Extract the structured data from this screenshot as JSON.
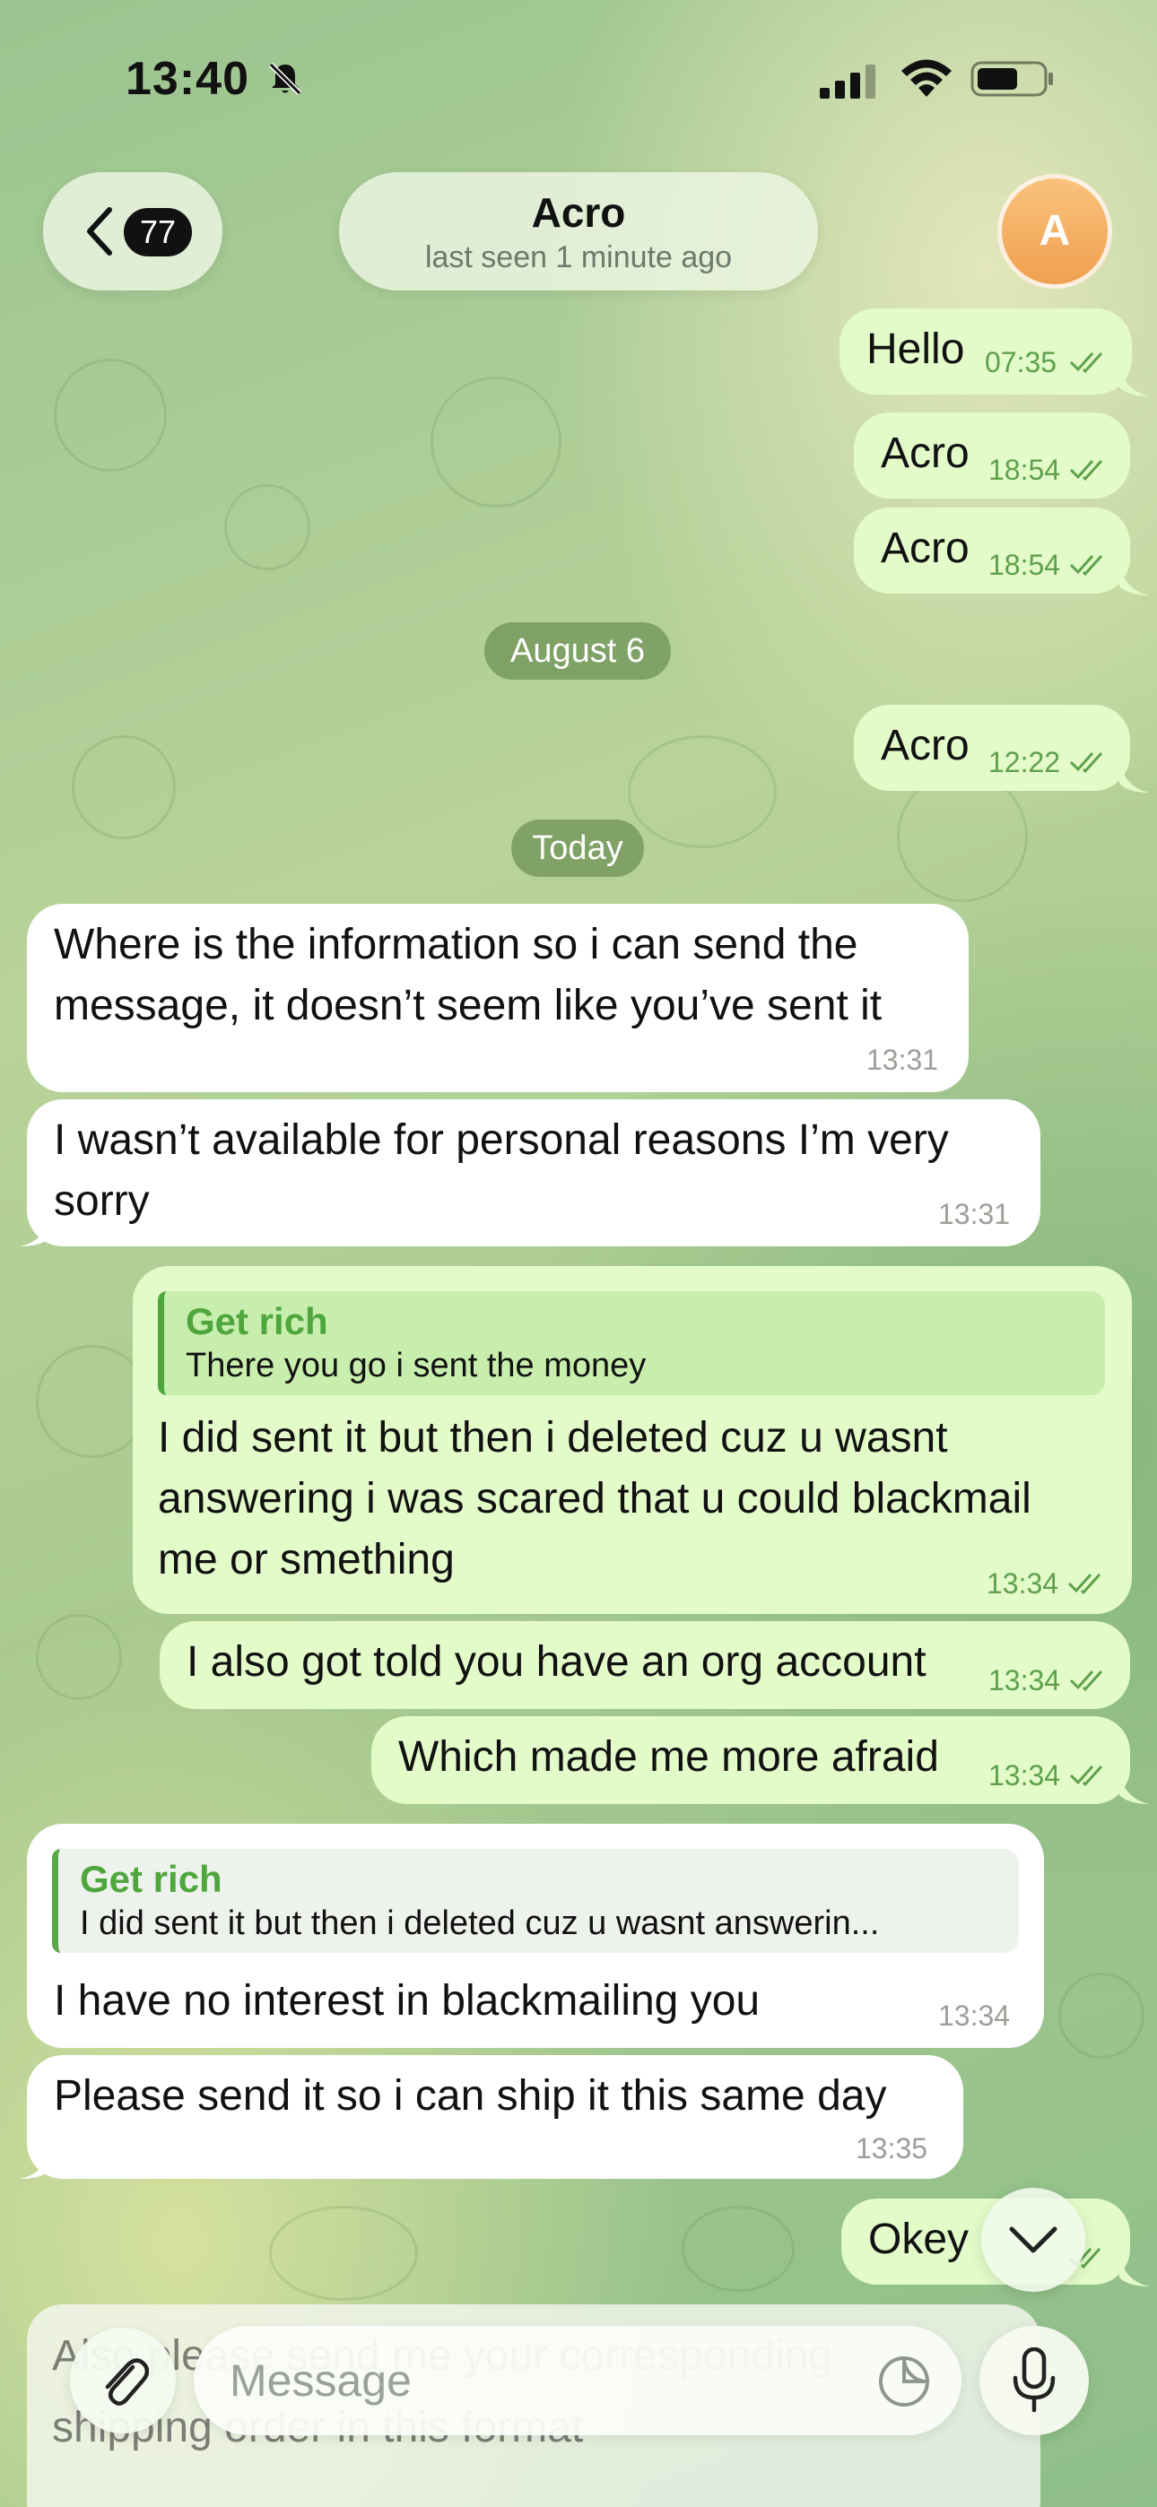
{
  "status_bar": {
    "time": "13:40"
  },
  "header": {
    "back_count": "77",
    "contact_name": "Acro",
    "last_seen": "last seen 1 minute ago",
    "avatar_initial": "A"
  },
  "date_chips": [
    "August 6",
    "Today"
  ],
  "messages": [
    {
      "dir": "out",
      "text": "Hello",
      "time": "07:35",
      "read": true
    },
    {
      "dir": "out",
      "text": "Acro",
      "time": "18:54",
      "read": true
    },
    {
      "dir": "out",
      "text": "Acro",
      "time": "18:54",
      "read": true
    },
    {
      "dir": "out",
      "text": "Acro",
      "time": "12:22",
      "read": true
    },
    {
      "dir": "in",
      "lines": [
        "Where is the information so i can send the",
        "message, it doesn’t seem like you’ve sent it"
      ],
      "time": "13:31"
    },
    {
      "dir": "in",
      "lines": [
        "I wasn’t available for personal reasons I’m very",
        "sorry"
      ],
      "time": "13:31"
    },
    {
      "dir": "out",
      "reply_name": "Get rich",
      "reply_text": "There you go i sent the money",
      "lines": [
        "I did sent it but then i deleted cuz u wasnt",
        "answering i was scared that u could blackmail",
        "me or smething"
      ],
      "time": "13:34",
      "read": true
    },
    {
      "dir": "out",
      "text": "I also got told you have an org account",
      "time": "13:34",
      "read": true
    },
    {
      "dir": "out",
      "text": "Which made me more afraid",
      "time": "13:34",
      "read": true
    },
    {
      "dir": "in",
      "reply_name": "Get rich",
      "reply_text": "I did sent it but then i deleted cuz u wasnt answerin...",
      "text": "I have no interest in blackmailing you",
      "time": "13:34"
    },
    {
      "dir": "in",
      "text": "Please send it so i can ship it this same day",
      "time": "13:35"
    },
    {
      "dir": "out",
      "text": "Okey",
      "read": true
    }
  ],
  "composer": {
    "draft_lines": [
      "Also please send me your corresponding",
      "shipping order in this format"
    ],
    "placeholder": "Message"
  },
  "colors": {
    "outgoing_bubble": "#e3fbc9",
    "incoming_bubble": "#ffffff",
    "accent_green": "#4fa63d"
  },
  "icons": [
    "bell-off-icon",
    "signal-icon",
    "wifi-icon",
    "battery-icon",
    "chevron-left-icon",
    "double-check-icon",
    "chevron-down-icon",
    "paperclip-icon",
    "sticker-icon",
    "microphone-icon"
  ]
}
